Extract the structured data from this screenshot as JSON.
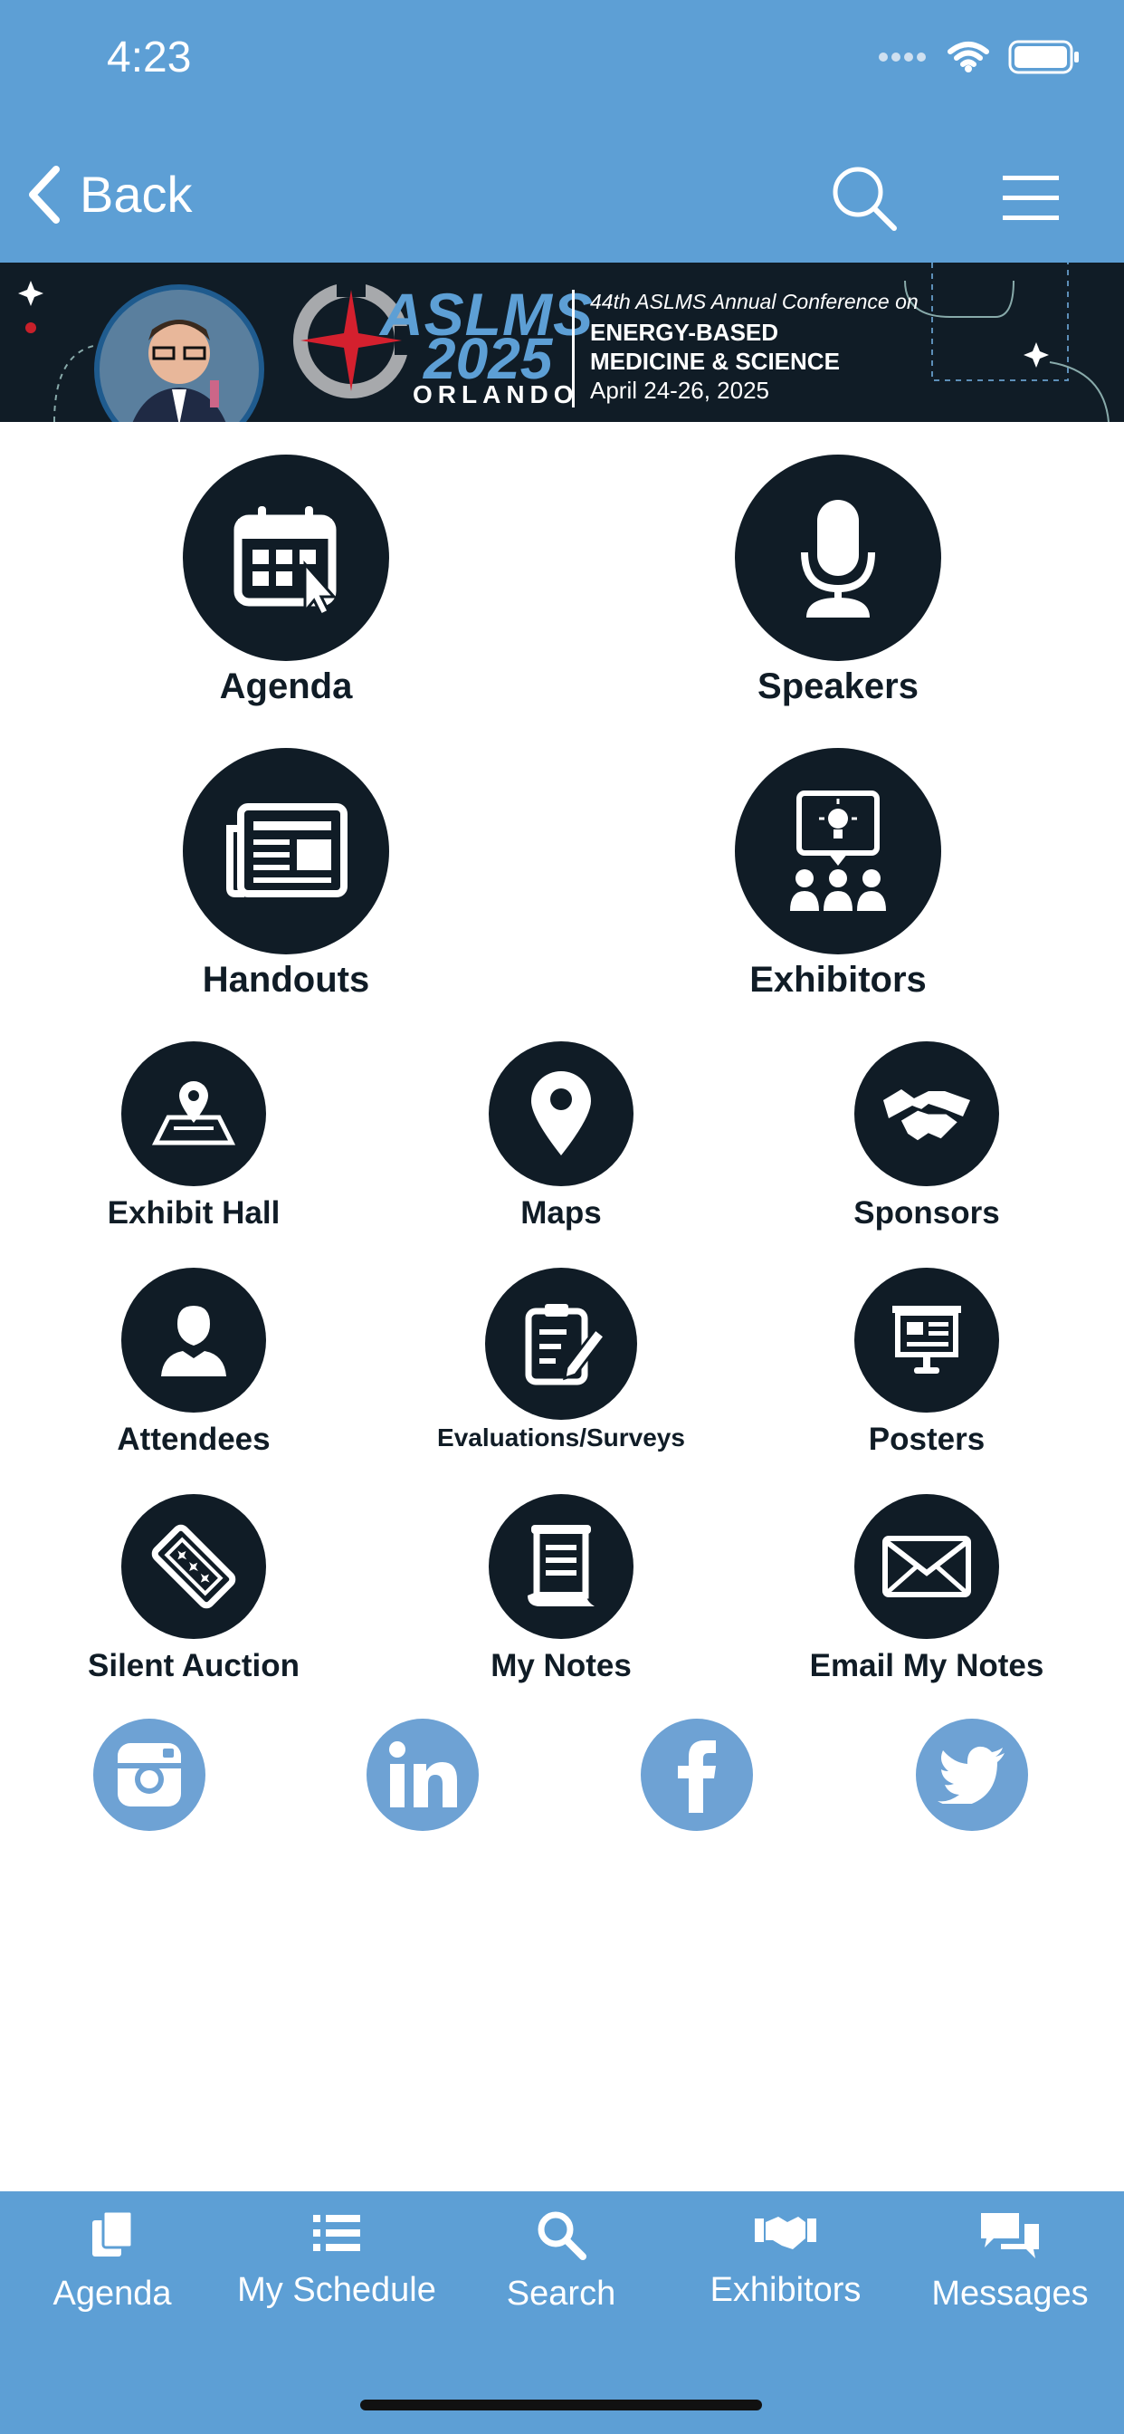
{
  "status_bar": {
    "time": "4:23"
  },
  "nav": {
    "back_label": "Back"
  },
  "banner": {
    "brand": "ASLMS",
    "year": "2025",
    "city": "ORLANDO",
    "headline": "44th ASLMS Annual Conference on",
    "line1": "ENERGY-BASED",
    "line2": "MEDICINE & SCIENCE",
    "dates": "April 24-26, 2025"
  },
  "tiles": {
    "agenda": "Agenda",
    "speakers": "Speakers",
    "handouts": "Handouts",
    "exhibitors": "Exhibitors",
    "exhibit_hall": "Exhibit Hall",
    "maps": "Maps",
    "sponsors": "Sponsors",
    "attendees": "Attendees",
    "evaluations": "Evaluations/Surveys",
    "posters": "Posters",
    "silent_auction": "Silent Auction",
    "my_notes": "My Notes",
    "email_notes": "Email My Notes"
  },
  "social_icons": [
    "instagram-icon",
    "linkedin-icon",
    "facebook-icon",
    "twitter-icon"
  ],
  "tabbar": {
    "agenda": "Agenda",
    "my_schedule": "My Schedule",
    "search": "Search",
    "exhibitors": "Exhibitors",
    "messages": "Messages"
  },
  "colors": {
    "header": "#5d9fd5",
    "tile": "#101c26",
    "social": "#6ea2d4"
  }
}
